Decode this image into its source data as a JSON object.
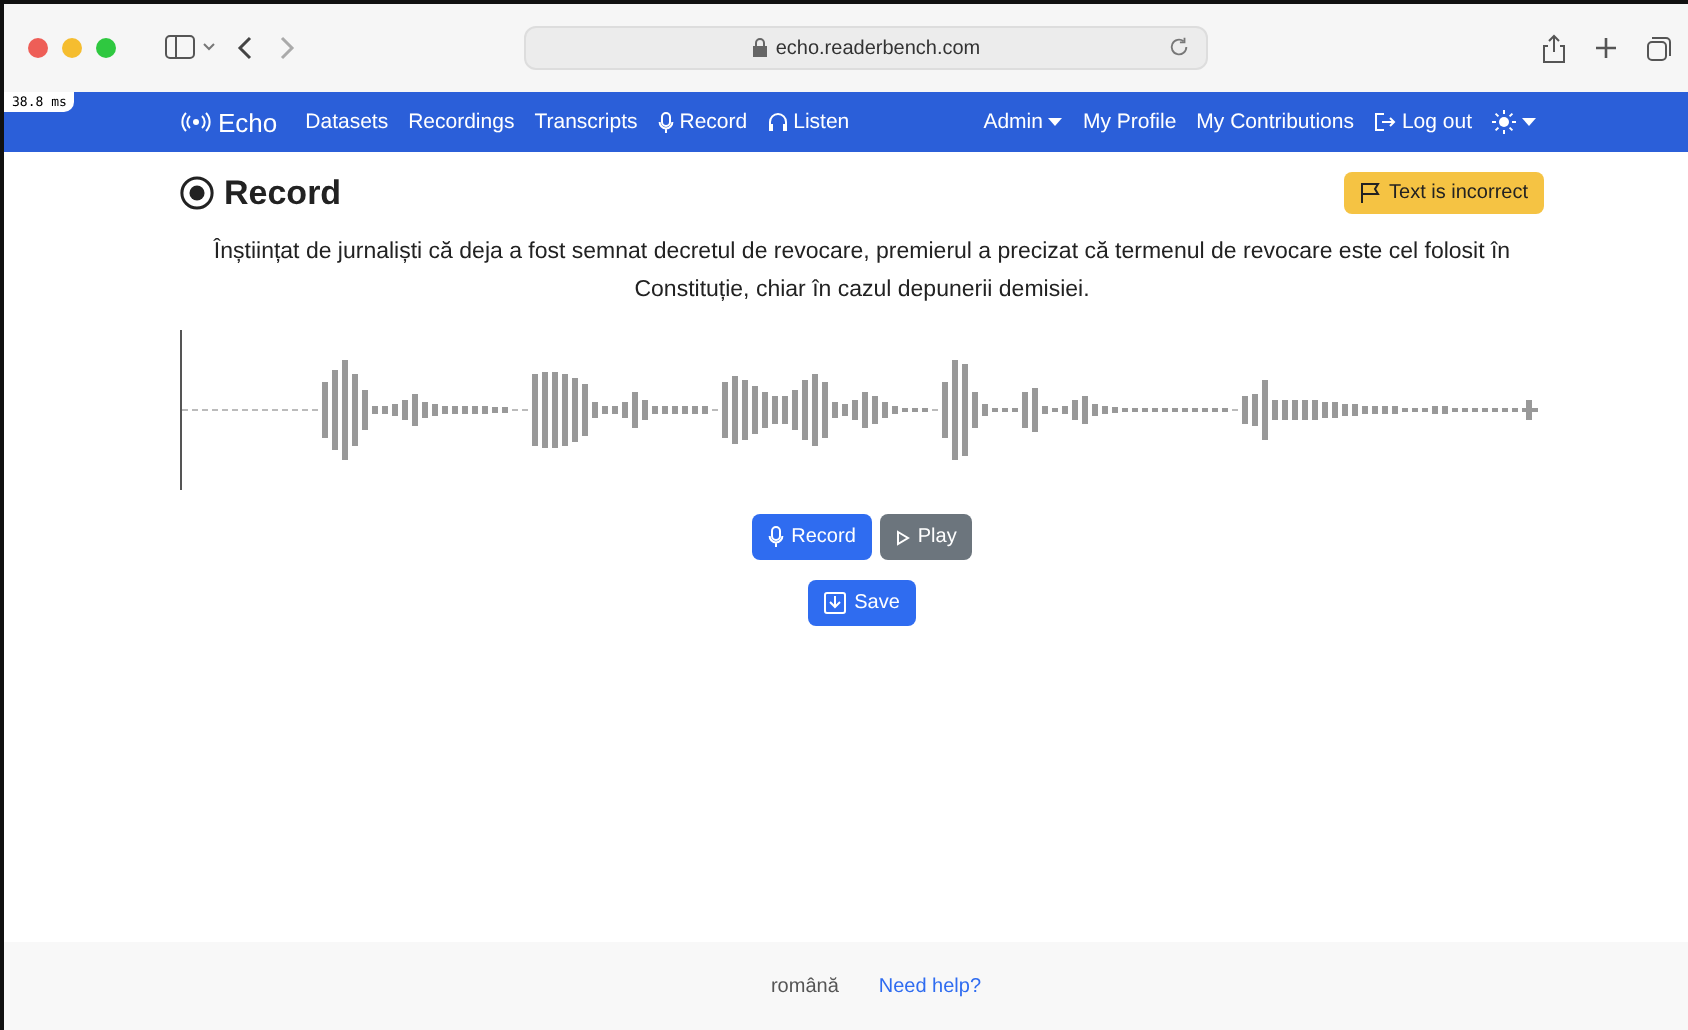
{
  "browser": {
    "address": "echo.readerbench.com",
    "timing": "38.8 ms"
  },
  "navbar": {
    "brand": "Echo",
    "links": [
      {
        "label": "Datasets",
        "kind": "text"
      },
      {
        "label": "Recordings",
        "kind": "text"
      },
      {
        "label": "Transcripts",
        "kind": "text"
      },
      {
        "label": "Record",
        "kind": "mic"
      },
      {
        "label": "Listen",
        "kind": "headphones"
      }
    ],
    "right_links": [
      {
        "label": "Admin",
        "kind": "dropdown"
      },
      {
        "label": "My Profile",
        "kind": "text"
      },
      {
        "label": "My Contributions",
        "kind": "text"
      },
      {
        "label": "Log out",
        "kind": "logout"
      }
    ]
  },
  "page": {
    "title": "Record",
    "report_button": "Text is incorrect",
    "prompt": "Înștiințat de jurnaliști că deja a fost semnat decretul de revocare, premierul a precizat că termenul de revocare este cel folosit în Constituție, chiar în cazul depunerii demisiei.",
    "buttons": [
      {
        "label": "Record",
        "kind": "primary"
      },
      {
        "label": "Play",
        "kind": "secondary"
      }
    ],
    "save_button": "Save"
  },
  "footer": {
    "language": "română",
    "help": "Need help?"
  }
}
